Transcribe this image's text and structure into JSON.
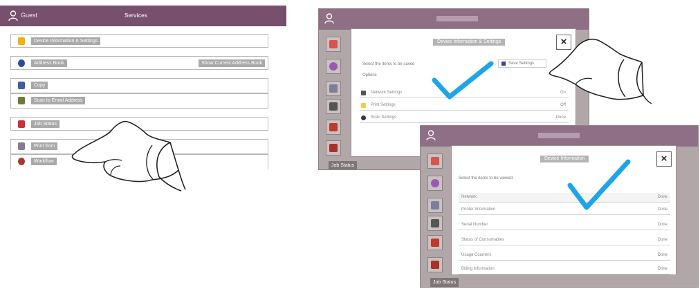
{
  "left_screen": {
    "header": {
      "user_name": "Guest",
      "title": "Services"
    },
    "items": [
      {
        "label": "Device Information & Settings",
        "right_label": "",
        "icon_color": "#f0b400"
      },
      {
        "label": "Address Book",
        "right_label": "Show Current Address Book",
        "icon_color": "#2a4d9c"
      },
      {
        "label": "Copy",
        "right_label": "",
        "icon_color": "#3f5f9e"
      },
      {
        "label": "Scan to Email Address",
        "right_label": "",
        "icon_color": "#6c7a3a"
      },
      {
        "label": "Job Status",
        "right_label": "",
        "icon_color": "#c8323a"
      },
      {
        "label": "Print from",
        "right_label": "",
        "icon_color": "#8a7a8e"
      },
      {
        "label": "Workflow",
        "right_label": "",
        "icon_color": "#a53a2d"
      }
    ]
  },
  "screen_top": {
    "modal_title": "Device Information & Settings",
    "subheading": "Select the items to be saved",
    "section_label": "Options",
    "button_label": "Save Settings",
    "rows": [
      {
        "label": "Network Settings",
        "value": "On",
        "icon_color": "#555555"
      },
      {
        "label": "Print Settings",
        "value": "Off",
        "icon_color": "#e8d24a"
      },
      {
        "label": "Scan Settings",
        "value": "Done",
        "icon_color": "#333355"
      }
    ],
    "close_glyph": "×",
    "bottom_label": "Job Status"
  },
  "screen_bottom": {
    "modal_title": "Device Information",
    "subheading": "Select the items to be viewed",
    "rows": [
      {
        "label": "Network",
        "value": "Done"
      },
      {
        "label": "Printer Information",
        "value": "Done"
      },
      {
        "label": "Serial Number",
        "value": "Done"
      },
      {
        "label": "Status of Consumables",
        "value": "Done"
      },
      {
        "label": "Usage Counters",
        "value": "Done"
      },
      {
        "label": "Billing Information",
        "value": "Done"
      }
    ],
    "close_glyph": "×",
    "bottom_label": "Job Status"
  },
  "colors": {
    "header": "#76506d",
    "checkmark": "#1ea5e8"
  },
  "icons": [
    "user-icon",
    "close-icon",
    "checkmark-icon",
    "pointing-hand-icon"
  ]
}
